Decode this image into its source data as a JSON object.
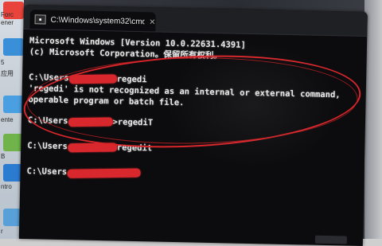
{
  "desktop": {
    "labels": [
      "Forc",
      "ener",
      "5",
      "应用",
      "ente",
      "B",
      "ntro",
      "r"
    ],
    "icon_colors": [
      "#e8443c",
      "#3a8fd9",
      "#4a9fe0",
      "#6fb34a",
      "#2b7bd1",
      "#5aa0d8"
    ]
  },
  "window": {
    "tab_title": "C:\\Windows\\system32\\cmd.e",
    "tab_icon_glyph": "▪",
    "close_glyph": "×"
  },
  "console": {
    "banner_line1": "Microsoft Windows [Version 10.0.22631.4391]",
    "banner_line2": "(c) Microsoft Corporation。保留所有权利。",
    "prompt_prefix": "C:\\Users",
    "cmd1": "regedi",
    "error_line1": "'regedi' is not recognized as an internal or external command,",
    "error_line2": "operable program or batch file.",
    "cmd2": ">regediT",
    "cmd3": "regedit"
  },
  "annotation": {
    "color": "#d8262b"
  }
}
